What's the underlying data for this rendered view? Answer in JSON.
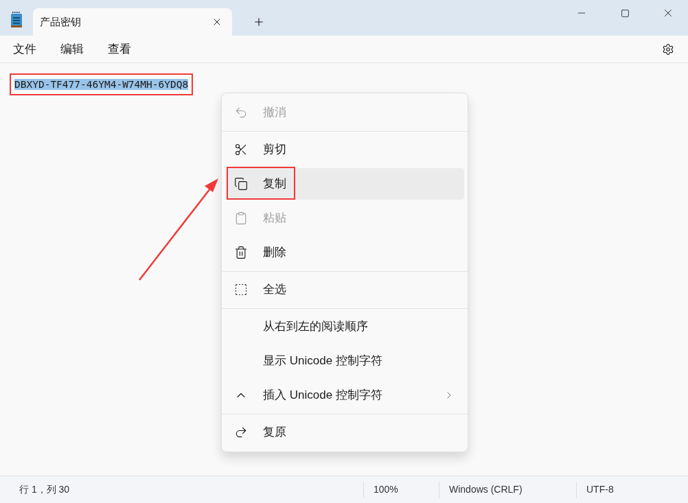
{
  "tabs": [
    {
      "label": "产品密钥",
      "selected": true
    }
  ],
  "menu_bar": [
    "文件",
    "编辑",
    "查看"
  ],
  "editor": {
    "text": "DBXYD-TF477-46YM4-W74MH-6YDQ8",
    "text_selected": true,
    "annotated": true
  },
  "context_menu": [
    {
      "kind": "item",
      "label": "撤消",
      "disabled": true,
      "selected": false
    },
    {
      "kind": "separator"
    },
    {
      "kind": "item",
      "label": "剪切",
      "disabled": false,
      "selected": false
    },
    {
      "kind": "item",
      "label": "复制",
      "disabled": false,
      "selected": true,
      "annotated": true
    },
    {
      "kind": "item",
      "label": "粘贴",
      "disabled": true,
      "selected": false
    },
    {
      "kind": "item",
      "label": "删除",
      "disabled": false,
      "selected": false
    },
    {
      "kind": "separator"
    },
    {
      "kind": "item",
      "label": "全选",
      "disabled": false,
      "selected": false
    },
    {
      "kind": "separator"
    },
    {
      "kind": "item",
      "label": "从右到左的阅读顺序",
      "disabled": false,
      "selected": false
    },
    {
      "kind": "item",
      "label": "显示 Unicode 控制字符",
      "disabled": false,
      "selected": false
    },
    {
      "kind": "item",
      "label": "插入 Unicode 控制字符",
      "disabled": false,
      "selected": false,
      "submenu": true
    },
    {
      "kind": "separator"
    },
    {
      "kind": "item",
      "label": "复原",
      "disabled": false,
      "selected": false
    }
  ],
  "status_bar": [
    "行 1，列 30",
    "100%",
    "Windows (CRLF)",
    "UTF-8"
  ]
}
